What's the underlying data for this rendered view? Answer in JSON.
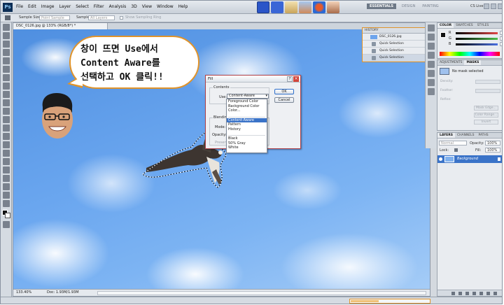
{
  "app": {
    "logo": "Ps",
    "menu": [
      "File",
      "Edit",
      "Image",
      "Layer",
      "Select",
      "Filter",
      "Analysis",
      "3D",
      "View",
      "Window",
      "Help"
    ],
    "workspaces": [
      "ESSENTIALS",
      "DESIGN",
      "PAINTING"
    ],
    "cs_live": "CS Live"
  },
  "options": {
    "sample_size_label": "Sample Size:",
    "sample_size_value": "Point Sample",
    "sample_label": "Sample:",
    "sample_value": "All Layers",
    "show_ring": "Show Sampling Ring"
  },
  "document": {
    "tab": "DSC_0126.jpg @ 133% (RGB/8*) *",
    "zoom": "133.40%",
    "doc_size": "Doc: 1.93M/1.93M"
  },
  "annotation": {
    "line1": "창이 뜨면 Use에서",
    "line2": "Content Aware를",
    "line3": "선택하고 OK 클릭!!"
  },
  "fill_dialog": {
    "title": "Fill",
    "contents_group": "Contents",
    "use_label": "Use:",
    "use_value": "Content-Aware",
    "blending_group": "Blending",
    "mode_label": "Mode:",
    "opacity_label": "Opacity:",
    "preserve_label": "Preserve",
    "ok": "OK",
    "cancel": "Cancel",
    "help": "?",
    "close": "×",
    "options": [
      "Foreground Color",
      "Background Color",
      "Color...",
      "Content-Aware",
      "Pattern",
      "History",
      "Black",
      "50% Gray",
      "White"
    ],
    "highlighted": "Content-Aware"
  },
  "history": {
    "tab": "HISTORY",
    "items": [
      "DSC_0126.jpg",
      "Quick Selection",
      "Quick Selection",
      "Quick Selection"
    ]
  },
  "color_panel": {
    "tabs": [
      "COLOR",
      "SWATCHES",
      "STYLES"
    ],
    "channels": [
      "R",
      "G",
      "B"
    ],
    "colors": {
      "r": "#e14646",
      "g": "#4cbf4c",
      "b": "#4a6fe0"
    }
  },
  "masks_panel": {
    "tabs": [
      "ADJUSTMENTS",
      "MASKS"
    ],
    "no_mask": "No mask selected",
    "density": "Density:",
    "feather": "Feather:",
    "refine": "Refine:",
    "mask_edge": "Mask Edge...",
    "color_range": "Color Range...",
    "invert": "Invert"
  },
  "layers_panel": {
    "tabs": [
      "LAYERS",
      "CHANNELS",
      "PATHS"
    ],
    "blend": "Normal",
    "opacity_label": "Opacity:",
    "opacity_value": "100%",
    "lock_label": "Lock:",
    "fill_label": "Fill:",
    "fill_value": "100%",
    "layer_name": "Background"
  }
}
